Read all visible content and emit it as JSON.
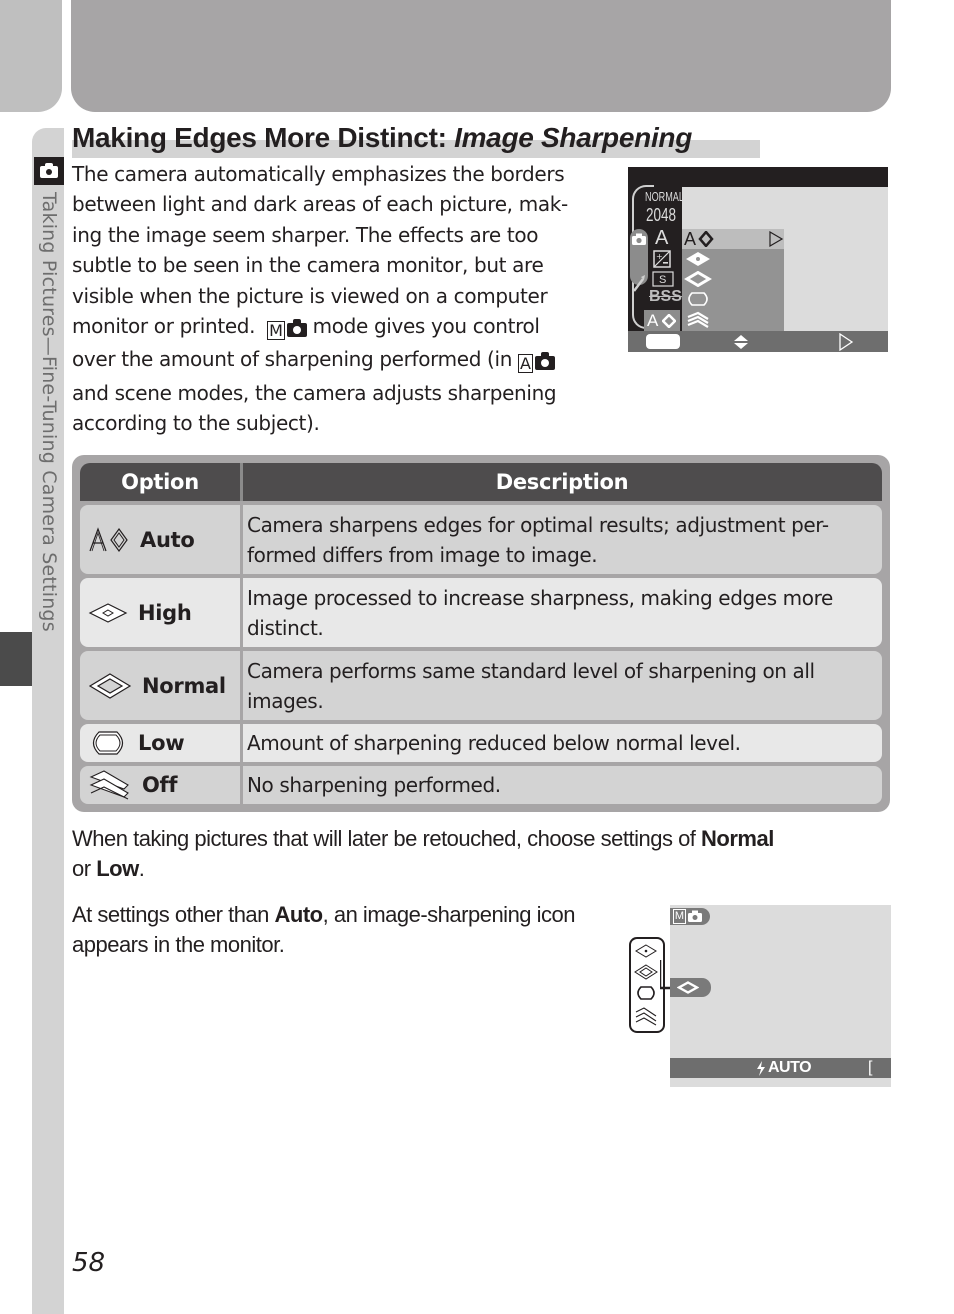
{
  "page": {
    "section_tab": "Taking Pictures—Fine-Tuning Camera Settings",
    "title_plain": "Making Edges More Distinct: ",
    "title_italic": "Image Sharpening",
    "page_number": "58"
  },
  "intro": {
    "lines": [
      "The camera automatically emphasizes the borders",
      "between light and dark areas of each picture, mak-",
      "ing the image seem sharper.  The effects are too",
      "subtle to be seen in the camera monitor, but are",
      "visible when the picture is viewed on a computer"
    ],
    "line6_a": "monitor or printed.  ",
    "line6_mode": "M",
    "line6_b": " mode gives you control",
    "line7_a": "over the amount of sharpening performed (in ",
    "line7_mode": "A",
    "line8": "and scene modes, the camera adjusts sharpening",
    "line9": "according to the subject)."
  },
  "camera_menu_screen": {
    "left_labels": [
      "NORMAL",
      "2048",
      "A"
    ],
    "selected_item": "A",
    "bottom_current": "A",
    "items": [
      "auto",
      "high",
      "normal",
      "low",
      "off"
    ]
  },
  "table": {
    "headers": {
      "option": "Option",
      "description": "Description"
    },
    "rows": [
      {
        "icon": "sharpen-auto-icon",
        "option": "Auto",
        "description": "Camera sharpens edges for optimal results; adjustment per-formed differs from image to image.",
        "desc_lines": [
          "Camera sharpens edges for optimal results; adjustment per-",
          "formed differs from image to image."
        ]
      },
      {
        "icon": "sharpen-high-icon",
        "option": "High",
        "description": "Image processed to increase sharpness, making edges more distinct.",
        "desc_lines": [
          "Image processed to increase sharpness, making edges more",
          "distinct."
        ]
      },
      {
        "icon": "sharpen-normal-icon",
        "option": "Normal",
        "description": "Camera performs same standard level of sharpening on all images.",
        "desc_lines": [
          "Camera performs same standard level of sharpening on all",
          "images."
        ]
      },
      {
        "icon": "sharpen-low-icon",
        "option": "Low",
        "description": "Amount of sharpening reduced below normal level.",
        "desc_lines": [
          "Amount of sharpening reduced below normal level."
        ]
      },
      {
        "icon": "sharpen-off-icon",
        "option": "Off",
        "description": "No sharpening performed.",
        "desc_lines": [
          "No sharpening performed."
        ]
      }
    ]
  },
  "notes": {
    "retouch_a": "When taking pictures that will later be retouched, choose settings of ",
    "retouch_b1": "Normal",
    "retouch_c": "or ",
    "retouch_b2": "Low",
    "retouch_d": ".",
    "monitor_a": "At settings other than ",
    "monitor_b": "Auto",
    "monitor_c": ", an image-sharpening icon appears in the monitor."
  },
  "monitor_screen": {
    "mode": "M",
    "flash": "AUTO",
    "flash_symbol": "ϟ",
    "bracket": "["
  },
  "colors": {
    "banner": "#a7a5a6",
    "table_header": "#4e4c4d",
    "row_dark": "#d3d3d3",
    "row_light": "#e8e8e8",
    "side_strip": "#d3d3d3"
  }
}
